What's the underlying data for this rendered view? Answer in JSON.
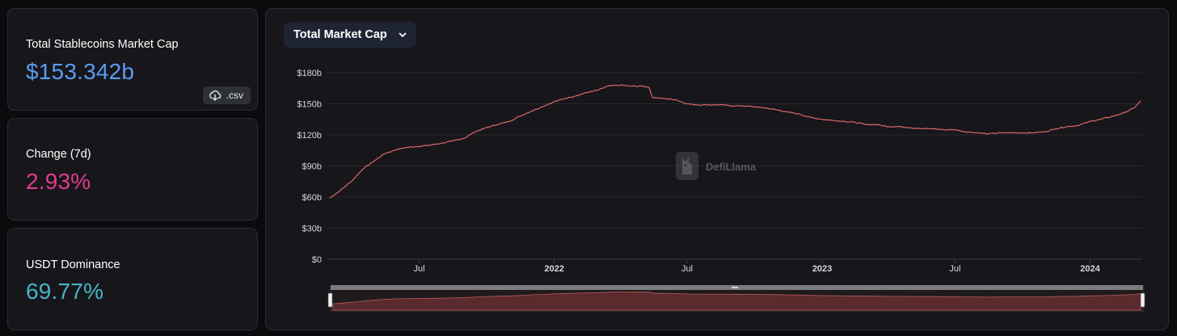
{
  "stats": [
    {
      "label": "Total Stablecoins Market Cap",
      "value": "$153.342b",
      "color": "#5b9cf2"
    },
    {
      "label": "Change (7d)",
      "value": "2.93%",
      "color": "#e33a8f"
    },
    {
      "label": "USDT Dominance",
      "value": "69.77%",
      "color": "#47b4c6"
    }
  ],
  "csv_button": {
    "label": ".csv",
    "icon": "cloud-download-icon"
  },
  "dropdown": {
    "label": "Total Market Cap",
    "icon": "chevron-down-icon"
  },
  "watermark": {
    "text": "DefiLlama",
    "icon": "llama-logo-icon"
  },
  "chart_data": {
    "type": "line",
    "x_start": "2021-03",
    "x_end": "2024-03",
    "y_label": "Total Market Cap",
    "ylim": [
      0,
      180
    ],
    "unit": "$b",
    "y_ticks": [
      "$0",
      "$30b",
      "$60b",
      "$90b",
      "$120b",
      "$150b",
      "$180b"
    ],
    "x_ticks": [
      {
        "label": "Jul",
        "date": "2021-07",
        "bold": false
      },
      {
        "label": "2022",
        "date": "2022-01",
        "bold": true
      },
      {
        "label": "Jul",
        "date": "2022-07",
        "bold": false
      },
      {
        "label": "2023",
        "date": "2023-01",
        "bold": true
      },
      {
        "label": "Jul",
        "date": "2023-07",
        "bold": false
      },
      {
        "label": "2024",
        "date": "2024-01",
        "bold": true
      }
    ],
    "series": [
      {
        "color": "#e8706a",
        "x": [
          "2021-03-01",
          "2021-03-15",
          "2021-04-01",
          "2021-04-15",
          "2021-05-01",
          "2021-05-15",
          "2021-06-01",
          "2021-06-15",
          "2021-07-01",
          "2021-07-15",
          "2021-08-01",
          "2021-08-15",
          "2021-09-01",
          "2021-09-15",
          "2021-10-01",
          "2021-10-15",
          "2021-11-01",
          "2021-11-15",
          "2021-12-01",
          "2021-12-15",
          "2022-01-01",
          "2022-01-15",
          "2022-02-01",
          "2022-02-15",
          "2022-03-01",
          "2022-03-15",
          "2022-04-01",
          "2022-04-15",
          "2022-05-01",
          "2022-05-10",
          "2022-05-15",
          "2022-06-01",
          "2022-06-15",
          "2022-07-01",
          "2022-07-15",
          "2022-08-01",
          "2022-08-15",
          "2022-09-01",
          "2022-09-15",
          "2022-10-01",
          "2022-10-15",
          "2022-11-01",
          "2022-11-15",
          "2022-12-01",
          "2022-12-15",
          "2023-01-01",
          "2023-01-15",
          "2023-02-01",
          "2023-02-15",
          "2023-03-01",
          "2023-03-15",
          "2023-04-01",
          "2023-04-15",
          "2023-05-01",
          "2023-05-15",
          "2023-06-01",
          "2023-06-15",
          "2023-07-01",
          "2023-07-15",
          "2023-08-01",
          "2023-08-15",
          "2023-09-01",
          "2023-09-15",
          "2023-10-01",
          "2023-10-15",
          "2023-11-01",
          "2023-11-15",
          "2023-12-01",
          "2023-12-15",
          "2024-01-01",
          "2024-01-15",
          "2024-02-01",
          "2024-02-15",
          "2024-03-01",
          "2024-03-10"
        ],
        "values": [
          59,
          66,
          76,
          87,
          95,
          102,
          106,
          108,
          109,
          110,
          112,
          114,
          117,
          123,
          127,
          130,
          133,
          138,
          143,
          147,
          152,
          155,
          158,
          161,
          163,
          167,
          168,
          167,
          167,
          166,
          156,
          155,
          154,
          150,
          149,
          149,
          149,
          148,
          148,
          147,
          146,
          144,
          142,
          140,
          137,
          135,
          134,
          133,
          132,
          130,
          130,
          128,
          128,
          127,
          126,
          126,
          125,
          125,
          123,
          122,
          121,
          122,
          122,
          122,
          122,
          123,
          126,
          128,
          129,
          133,
          135,
          138,
          141,
          146,
          153
        ]
      }
    ]
  }
}
